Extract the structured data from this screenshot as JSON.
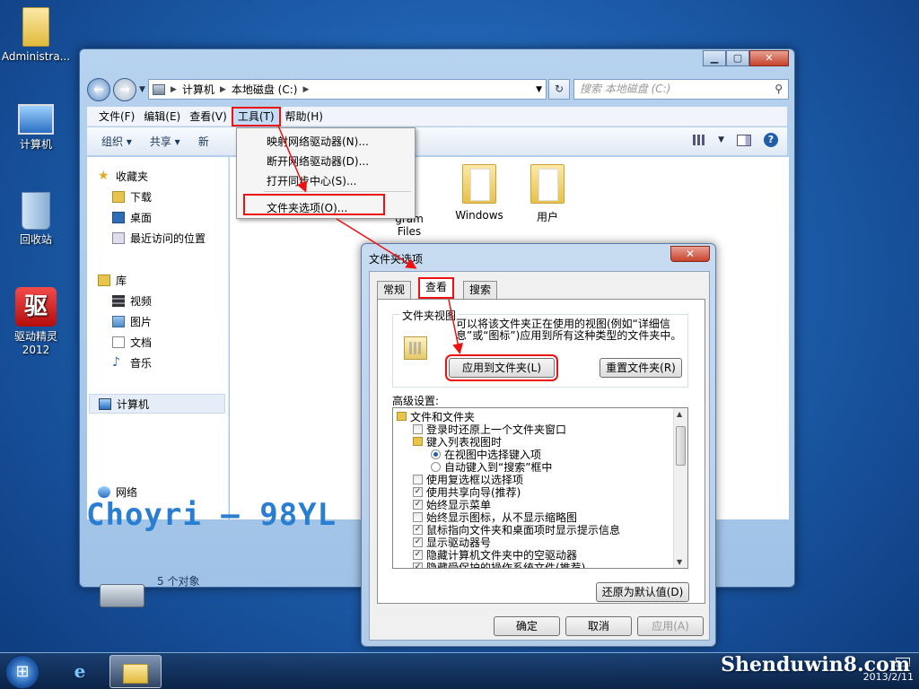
{
  "desktop": {
    "icons": [
      {
        "label": "Administra..."
      },
      {
        "label": "计算机"
      },
      {
        "label": "回收站"
      },
      {
        "label": "驱动精灵\n2012",
        "line1": "驱动精灵",
        "line2": "2012"
      }
    ]
  },
  "explorer": {
    "breadcrumb": [
      "计算机",
      "本地磁盘 (C:)"
    ],
    "search_placeholder": "搜索 本地磁盘 (C:)",
    "menu": [
      "文件(F)",
      "编辑(E)",
      "查看(V)",
      "工具(T)",
      "帮助(H)"
    ],
    "toolbar": {
      "organize": "组织 ▾",
      "share": "共享 ▾",
      "new": "新"
    },
    "nav_pane": {
      "favorites": "收藏夹",
      "favorites_items": [
        "下载",
        "桌面",
        "最近访问的位置"
      ],
      "library": "库",
      "library_items": [
        "视频",
        "图片",
        "文档",
        "音乐"
      ],
      "computer": "计算机",
      "network": "网络"
    },
    "folders": [
      {
        "line1": "gram",
        "line2": "Files"
      },
      {
        "line1": "Windows",
        "line2": ""
      },
      {
        "line1": "用户",
        "line2": ""
      }
    ],
    "status": "5 个对象"
  },
  "tools_menu": {
    "items": [
      "映射网络驱动器(N)...",
      "断开网络驱动器(D)...",
      "打开同步中心(S)...",
      "文件夹选项(O)..."
    ]
  },
  "dialog": {
    "title": "文件夹选项",
    "tabs": [
      "常规",
      "查看",
      "搜索"
    ],
    "folder_views": {
      "title": "文件夹视图",
      "text": "可以将该文件夹正在使用的视图(例如“详细信息”或“图标”)应用到所有这种类型的文件夹中。",
      "apply_button": "应用到文件夹(L)",
      "reset_button": "重置文件夹(R)"
    },
    "advanced_label": "高级设置:",
    "advanced_items": [
      {
        "text": "文件和文件夹",
        "kind": "folder",
        "checked": false
      },
      {
        "text": "登录时还原上一个文件夹窗口",
        "kind": "check",
        "checked": false
      },
      {
        "text": "键入列表视图时",
        "kind": "folder",
        "checked": false
      },
      {
        "text": "在视图中选择键入项",
        "kind": "radio",
        "checked": true
      },
      {
        "text": "自动键入到“搜索”框中",
        "kind": "radio",
        "checked": false
      },
      {
        "text": "使用复选框以选择项",
        "kind": "check",
        "checked": false
      },
      {
        "text": "使用共享向导(推荐)",
        "kind": "check",
        "checked": true
      },
      {
        "text": "始终显示菜单",
        "kind": "check",
        "checked": true
      },
      {
        "text": "始终显示图标，从不显示缩略图",
        "kind": "check",
        "checked": false
      },
      {
        "text": "鼠标指向文件夹和桌面项时显示提示信息",
        "kind": "check",
        "checked": true
      },
      {
        "text": "显示驱动器号",
        "kind": "check",
        "checked": true
      },
      {
        "text": "隐藏计算机文件夹中的空驱动器",
        "kind": "check",
        "checked": true
      },
      {
        "text": "隐藏受保护的操作系统文件(推荐)",
        "kind": "check",
        "checked": true
      }
    ],
    "restore_button": "还原为默认值(D)",
    "ok": "确定",
    "cancel": "取消",
    "apply": "应用(A)"
  },
  "watermark": "Choyri — 98YL",
  "taskbar": {
    "date": "2013/2/11",
    "brand": "Shenduwin8.com"
  },
  "colors": {
    "highlight": "#ee1111",
    "desktop": "#1e5fae"
  }
}
